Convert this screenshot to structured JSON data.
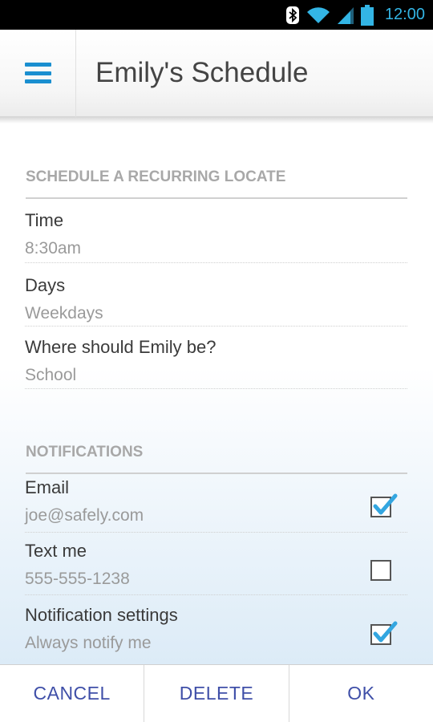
{
  "status_bar": {
    "time": "12:00",
    "icons": [
      "bluetooth-icon",
      "wifi-icon",
      "signal-icon",
      "battery-icon"
    ],
    "time_color": "#33b5e5"
  },
  "action_bar": {
    "title": "Emily's Schedule",
    "menu_icon": "hamburger-menu-icon",
    "accent_color": "#1a8fd0"
  },
  "schedule_section": {
    "header": "SCHEDULE A RECURRING LOCATE",
    "rows": [
      {
        "label": "Time",
        "value": "8:30am"
      },
      {
        "label": "Days",
        "value": "Weekdays"
      },
      {
        "label": "Where should Emily be?",
        "value": "School"
      }
    ]
  },
  "notifications_section": {
    "header": "NOTIFICATIONS",
    "rows": [
      {
        "label": "Email",
        "value": "joe@safely.com",
        "checked": true
      },
      {
        "label": "Text me",
        "value": "555-555-1238",
        "checked": false
      },
      {
        "label": "Notification settings",
        "value": "Always notify me",
        "checked": true
      }
    ]
  },
  "buttons": {
    "cancel": "CANCEL",
    "delete": "DELETE",
    "ok": "OK"
  }
}
